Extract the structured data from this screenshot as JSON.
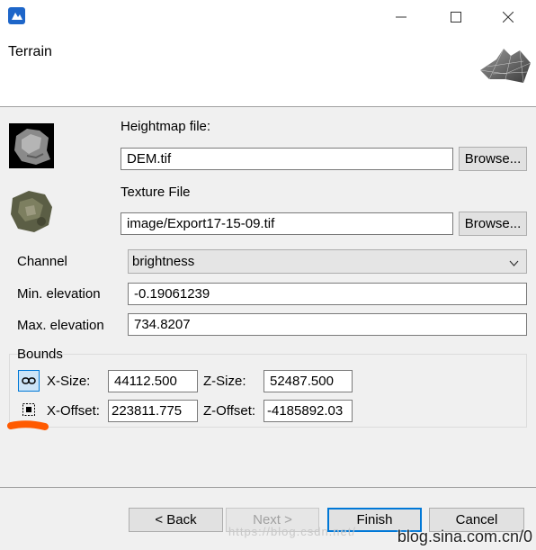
{
  "window": {
    "title": "Terrain"
  },
  "heightmap": {
    "label": "Heightmap file:",
    "value": "DEM.tif",
    "browse_label": "Browse..."
  },
  "texture": {
    "label": "Texture File",
    "value": "image/Export17-15-09.tif",
    "browse_label": "Browse..."
  },
  "channel": {
    "label": "Channel",
    "value": "brightness"
  },
  "min_elevation": {
    "label": "Min. elevation",
    "value": "-0.19061239"
  },
  "max_elevation": {
    "label": "Max. elevation",
    "value": "734.8207"
  },
  "bounds": {
    "label": "Bounds",
    "x_size_label": "X-Size:",
    "x_size": "44112.500",
    "z_size_label": "Z-Size:",
    "z_size": "52487.500",
    "x_offset_label": "X-Offset:",
    "x_offset": "223811.775",
    "z_offset_label": "Z-Offset:",
    "z_offset": "-4185892.03"
  },
  "footer": {
    "back_label": "< Back",
    "next_label": "Next >",
    "finish_label": "Finish",
    "cancel_label": "Cancel"
  },
  "watermark": {
    "text": "blog.sina.com.cn/0",
    "faint_text": "https://blog.csdn.net/"
  },
  "colors": {
    "accent": "#0078d7",
    "annotation": "#ff5a00"
  }
}
